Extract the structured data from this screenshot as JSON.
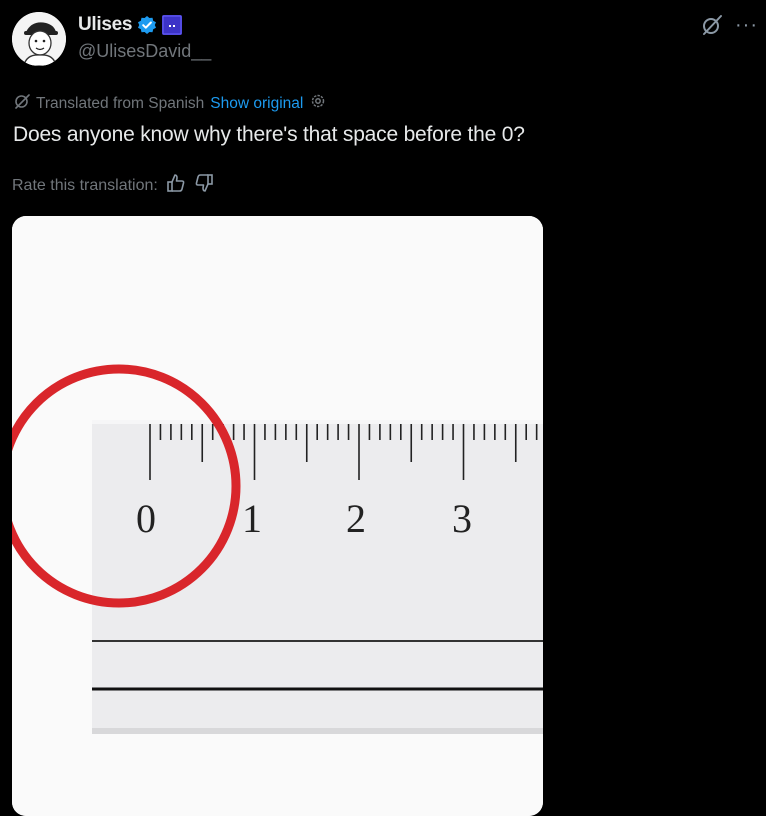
{
  "author": {
    "display_name": "Ulises",
    "handle": "@UlisesDavid__",
    "verified_color": "#1d9bf0",
    "affiliate_badge_color": "#3c33c7"
  },
  "translation": {
    "notice": "Translated from Spanish",
    "show_original": "Show original",
    "rate_label": "Rate this translation:"
  },
  "tweet": {
    "text": "Does anyone know why there's that space before the 0?"
  },
  "media": {
    "ruler_numbers": [
      "0",
      "1",
      "2",
      "3"
    ],
    "highlight_color": "#d9262b"
  },
  "icons": {
    "grok": "grok-icon",
    "more": "more-icon",
    "gear": "gear-icon",
    "thumbs_up": "thumbs-up-icon",
    "thumbs_down": "thumbs-down-icon"
  }
}
